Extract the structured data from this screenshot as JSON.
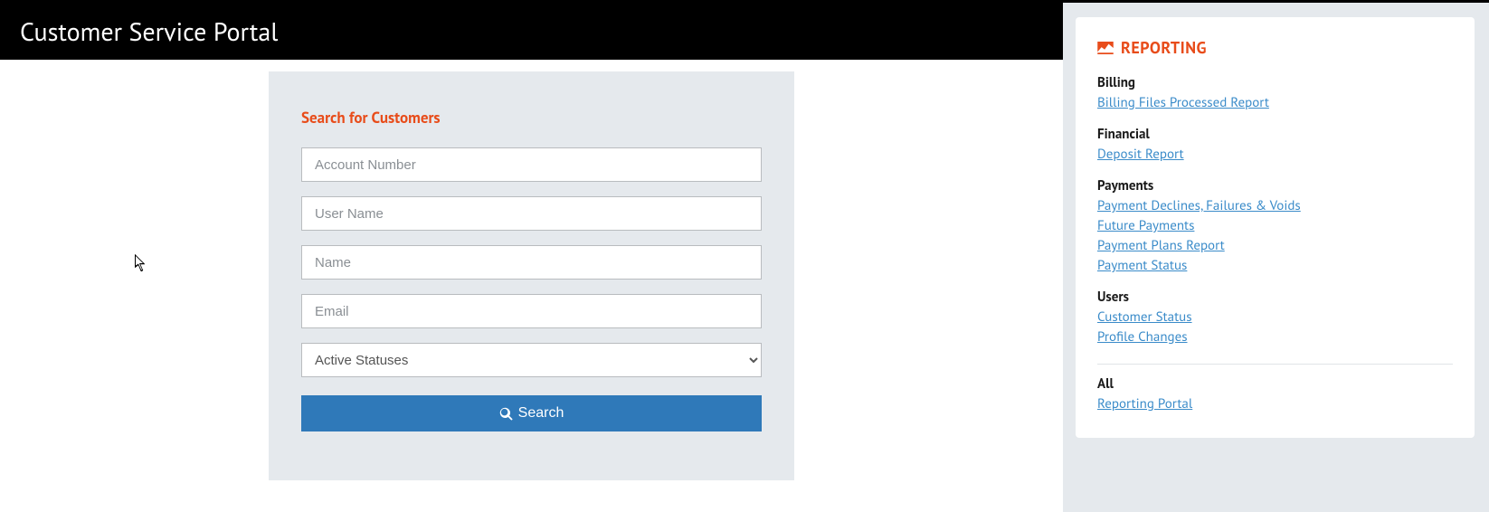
{
  "header": {
    "title": "Customer Service Portal"
  },
  "search": {
    "title": "Search for Customers",
    "fields": {
      "account_number_placeholder": "Account Number",
      "user_name_placeholder": "User Name",
      "name_placeholder": "Name",
      "email_placeholder": "Email"
    },
    "status_select": {
      "selected": "Active Statuses"
    },
    "button_label": "Search"
  },
  "reporting": {
    "title": "REPORTING",
    "groups": [
      {
        "title": "Billing",
        "links": [
          "Billing Files Processed Report"
        ]
      },
      {
        "title": "Financial",
        "links": [
          "Deposit Report"
        ]
      },
      {
        "title": "Payments",
        "links": [
          "Payment Declines, Failures & Voids",
          "Future Payments",
          "Payment Plans Report",
          "Payment Status"
        ]
      },
      {
        "title": "Users",
        "links": [
          "Customer Status",
          "Profile Changes"
        ]
      }
    ],
    "all": {
      "title": "All",
      "links": [
        "Reporting Portal"
      ]
    }
  }
}
